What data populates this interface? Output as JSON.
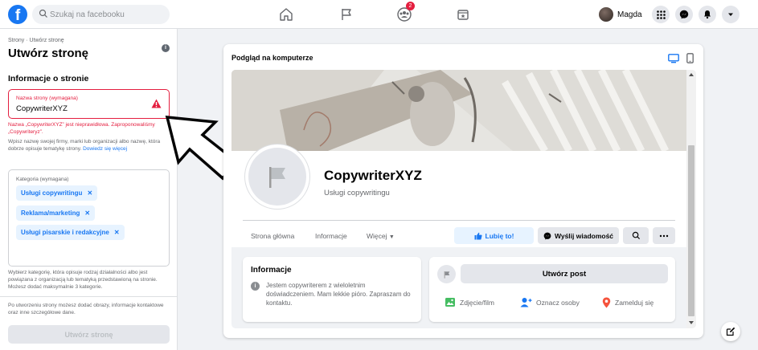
{
  "topbar": {
    "logo_letter": "f",
    "search_placeholder": "Szukaj na facebooku",
    "notifications_badge": "2",
    "user_name": "Magda"
  },
  "left": {
    "breadcrumb": "Strony · Utwórz stronę",
    "title": "Utwórz stronę",
    "section": "Informacje o stronie",
    "name_label": "Nazwa strony (wymagana)",
    "name_value": "CopywriterXYZ",
    "name_error": "Nazwa „CopywriterXYZ” jest nieprawidłowa. Zaproponowaliśmy „Copywriteryz”.",
    "name_help": "Wpisz nazwę swojej firmy, marki lub organizacji albo nazwę, która dobrze opisuje tematykę strony.",
    "name_help_link": "Dowiedz się więcej",
    "category_label": "Kategoria (wymagana)",
    "categories": [
      "Usługi copywritingu",
      "Reklama/marketing",
      "Usługi pisarskie i redakcyjne"
    ],
    "category_help": "Wybierz kategorię, która opisuje rodzaj działalności albo jest powiązana z organizacją lub tematyką przedstawioną na stronie. Możesz dodać maksymalnie 3 kategorie.",
    "after_text": "Po utworzeniu strony możesz dodać obrazy, informacje kontaktowe oraz inne szczegółowe dane.",
    "create_button": "Utwórz stronę"
  },
  "preview": {
    "title": "Podgląd na komputerze",
    "page_name": "CopywriterXYZ",
    "page_category": "Usługi copywritingu",
    "tabs": [
      "Strona główna",
      "Informacje",
      "Więcej"
    ],
    "like_button": "Lubię to!",
    "message_button": "Wyślij wiadomość",
    "info_title": "Informacje",
    "info_desc": "Jestem copywriterem z wieloletnim doświadczeniem. Mam lekkie pióro. Zapraszam do kontaktu.",
    "create_post": "Utwórz post",
    "actions": [
      "Zdjęcie/film",
      "Oznacz osoby",
      "Zamelduj się"
    ]
  },
  "colors": {
    "brand": "#1877f2",
    "error": "#e41e3f"
  }
}
